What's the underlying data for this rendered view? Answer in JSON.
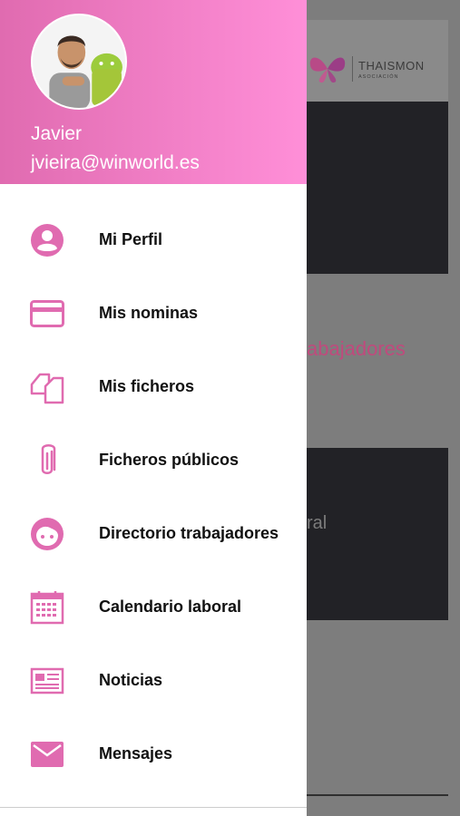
{
  "colors": {
    "accent": "#e06bb0",
    "header_gradient_start": "#e06bb0",
    "header_gradient_end": "#ff8fd8",
    "background_title": "#c04a7d"
  },
  "background": {
    "logo_name": "THAISMON",
    "logo_sub": "ASOCIACIÓN",
    "section_title_fragment": "abajadores",
    "card_text_fragment": "ral"
  },
  "drawer": {
    "user": {
      "name": "Javier",
      "email": "jvieira@winworld.es",
      "avatar_icon": "avatar-icon"
    },
    "menu": [
      {
        "label": "Mi Perfil",
        "icon": "user-circle-icon"
      },
      {
        "label": "Mis nominas",
        "icon": "credit-card-icon"
      },
      {
        "label": "Mis ficheros",
        "icon": "files-icon"
      },
      {
        "label": "Ficheros públicos",
        "icon": "paperclip-icon"
      },
      {
        "label": "Directorio trabajadores",
        "icon": "face-icon"
      },
      {
        "label": "Calendario laboral",
        "icon": "calendar-icon"
      },
      {
        "label": "Noticias",
        "icon": "newspaper-icon"
      },
      {
        "label": "Mensajes",
        "icon": "mail-icon"
      }
    ]
  }
}
